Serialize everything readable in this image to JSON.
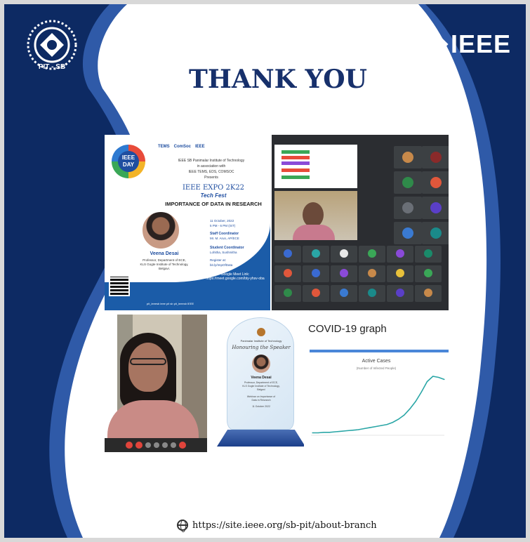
{
  "slide": {
    "title": "THANK YOU",
    "footer_url": "https://site.ieee.org/sb-pit/about-branch",
    "brand_logo": "IEEE",
    "branch_logo_label": "PIT - SB"
  },
  "poster": {
    "badge": "IEEE DAY",
    "sponsor_logos": [
      "TEMS",
      "ComSoc",
      "IEEE"
    ],
    "org_line1": "IEEE SB Panimalar Institute of Technology",
    "org_line2": "in association with",
    "org_line3": "IEEE TEMS, EDS, COMSOC",
    "org_line4": "Presents",
    "expo": "IEEE EXPO 2K22",
    "tech_fest": "Tech Fest",
    "topic": "IMPORTANCE OF DATA IN RESEARCH",
    "speaker_name": "Veena Desai",
    "speaker_role1": "Professor, Department of ECE,",
    "speaker_role2": "KLS Gogte Institute of Technology,",
    "speaker_role3": "Belgavi.",
    "date": "11 October, 2022",
    "time": "5 PM - 6 PM (IST)",
    "staff_label": "Staff Coordinator",
    "staff_name": "Mr. M. Arun, AP/ECE",
    "student_label": "Student Coordinator",
    "student_name": "Lohitha, Sushmitha",
    "register_label": "Register at:",
    "register_link": "bit.ly/ImpOfData",
    "meet_label": "Google Meet Link:",
    "meet_link": "https://meet.google.com/bty-yhsv-oba",
    "social": "pit_ieeesb   ieee pit sb   pit_ieeesb   IEEE"
  },
  "plaque": {
    "org": "Panimalar Institute of Technology",
    "script": "Honouring the Speaker",
    "name": "Veena Desai",
    "role1": "Professor, Department of ECE,",
    "role2": "KLS Gogte Institute of Technology,",
    "role3": "Belgavi",
    "webinar1": "Webinar on Importance of",
    "webinar2": "Data in Research",
    "date": "11 October 2022"
  },
  "covid": {
    "title": "COVID-19 graph",
    "accent_color": "#4a86d8",
    "line_color": "#2aa6a6"
  },
  "chart_data": {
    "type": "line",
    "title": "Active Cases",
    "subtitle": "(Number of Infected People)",
    "xlabel": "",
    "ylabel": "",
    "series": [
      {
        "values": [
          2,
          2,
          3,
          3,
          4,
          5,
          6,
          7,
          8,
          10,
          12,
          14,
          16,
          18,
          22,
          28,
          36,
          48,
          62,
          80,
          100,
          110,
          108,
          104
        ]
      }
    ]
  }
}
